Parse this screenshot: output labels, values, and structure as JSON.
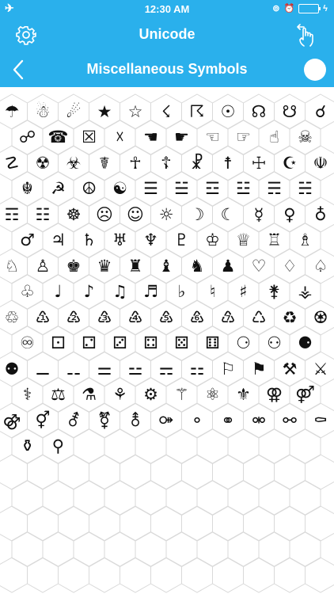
{
  "status": {
    "time": "12:30 AM",
    "airplane_icon": "airplane-icon",
    "battery_level": 0
  },
  "nav": {
    "title": "Unicode",
    "settings_icon": "gear-icon",
    "action_icon": "tap-hand-icon"
  },
  "sub": {
    "title": "Miscellaneous Symbols",
    "back_icon": "chevron-left-icon"
  },
  "accent": "#2ab0ec",
  "symbols": [
    "☂",
    "☃",
    "☄",
    "★",
    "☆",
    "☇",
    "☈",
    "☉",
    "☊",
    "☋",
    "☌",
    "☍",
    "☎",
    "☒",
    "☓",
    "☚",
    "☛",
    "☜",
    "☞",
    "☝",
    "☠",
    "☡",
    "☢",
    "☣",
    "☤",
    "☥",
    "☦",
    "☧",
    "☨",
    "☩",
    "☪",
    "☫",
    "☬",
    "☭",
    "☮",
    "☯",
    "☰",
    "☱",
    "☲",
    "☳",
    "☴",
    "☵",
    "☶",
    "☷",
    "☸",
    "☹",
    "☺",
    "☼",
    "☽",
    "☾",
    "☿",
    "♀",
    "♁",
    "♂",
    "♃",
    "♄",
    "♅",
    "♆",
    "♇",
    "♔",
    "♕",
    "♖",
    "♗",
    "♘",
    "♙",
    "♚",
    "♛",
    "♜",
    "♝",
    "♞",
    "♟",
    "♡",
    "♢",
    "♤",
    "♧",
    "♩",
    "♪",
    "♫",
    "♬",
    "♭",
    "♮",
    "♯",
    "⚵",
    "⚶",
    "♲",
    "♳",
    "♴",
    "♵",
    "♶",
    "♷",
    "♸",
    "♹",
    "♺",
    "♻",
    "♼",
    "♾",
    "⚀",
    "⚁",
    "⚂",
    "⚃",
    "⚄",
    "⚅",
    "⚆",
    "⚇",
    "⚈",
    "⚉",
    "⚊",
    "⚋",
    "⚌",
    "⚍",
    "⚎",
    "⚏",
    "⚐",
    "⚑",
    "⚒",
    "⚔",
    "⚕",
    "⚖",
    "⚗",
    "⚘",
    "⚙",
    "⚚",
    "⚛",
    "⚜",
    "⚢",
    "⚤",
    "⚣",
    "⚥",
    "⚦",
    "⚧",
    "⚨",
    "⚩",
    "⚬",
    "⚭",
    "⚮",
    "⚯",
    "⚰",
    "⚱",
    "⚲"
  ]
}
